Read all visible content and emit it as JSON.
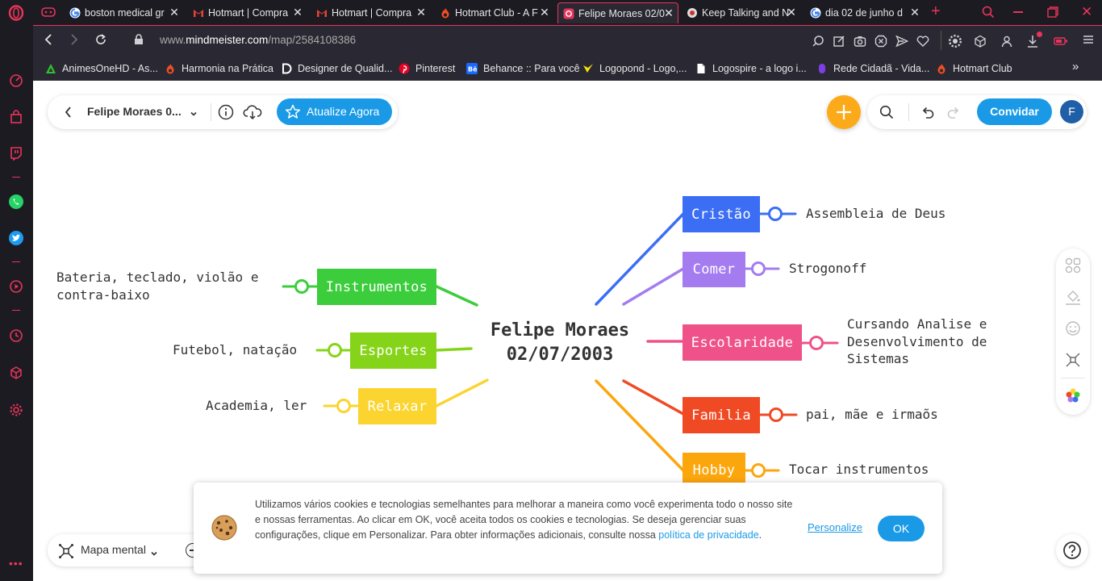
{
  "colors": {
    "browser_bg": "#1c1b22",
    "toolbar_bg": "#2a2933",
    "opera_red": "#e8345a",
    "accent_blue": "#1a9ae6",
    "add_orange": "#fcaa1a",
    "blue": "#3b6ef5",
    "purple": "#a47cf0",
    "pink": "#ef5289",
    "red": "#f04a24",
    "orange": "#fca60d",
    "green": "#3ccd3c",
    "lime": "#86d41a",
    "yellow": "#fbd42f"
  },
  "tabs": [
    {
      "title": "boston medical gr",
      "icon": "google-icon"
    },
    {
      "title": "Hotmart | Compra",
      "icon": "gmail-icon"
    },
    {
      "title": "Hotmart | Compra",
      "icon": "gmail-icon"
    },
    {
      "title": "Hotmart Club - A F",
      "icon": "hotmart-icon"
    },
    {
      "title": "Felipe Moraes 02/0",
      "icon": "mindmeister-icon",
      "active": true
    },
    {
      "title": "Keep Talking and N",
      "icon": "game-icon"
    },
    {
      "title": "dia 02 de junho d",
      "icon": "google-icon"
    }
  ],
  "address": {
    "prefix": "www.",
    "domain": "mindmeister.com",
    "path": "/map/2584108386"
  },
  "bookmarks": [
    {
      "label": "AnimesOneHD - As...",
      "icon": "animes-icon"
    },
    {
      "label": "Harmonia na Prática",
      "icon": "hotmart-icon"
    },
    {
      "label": "Designer de Qualid...",
      "icon": "designer-icon"
    },
    {
      "label": "Pinterest",
      "icon": "pinterest-icon"
    },
    {
      "label": "Behance :: Para você",
      "icon": "behance-icon"
    },
    {
      "label": "Logopond - Logo,...",
      "icon": "logopond-icon"
    },
    {
      "label": "Logospire - a logo i...",
      "icon": "file-icon"
    },
    {
      "label": "Rede Cidadã - Vida...",
      "icon": "rede-icon"
    },
    {
      "label": "Hotmart Club",
      "icon": "hotmart-icon"
    }
  ],
  "toolbar": {
    "map_title": "Felipe Moraes 0...",
    "upgrade_label": "Atualize Agora",
    "invite_label": "Convidar",
    "avatar_letter": "F"
  },
  "mindmap": {
    "root": "Felipe Moraes\n02/07/2003",
    "right": [
      {
        "label": "Cristão",
        "leaf": "Assembleia de Deus",
        "color": "#3b6ef5"
      },
      {
        "label": "Comer",
        "leaf": "Strogonoff",
        "color": "#a47cf0"
      },
      {
        "label": "Escolaridade",
        "leaf": "Cursando Analise e\nDesenvolvimento de\nSistemas",
        "color": "#ef5289"
      },
      {
        "label": "Familia",
        "leaf": "pai, mãe e irmaõs",
        "color": "#f04a24"
      },
      {
        "label": "Hobby",
        "leaf": "Tocar instrumentos",
        "color": "#fca60d"
      }
    ],
    "left": [
      {
        "label": "Instrumentos",
        "leaf": "Bateria, teclado, violão e\ncontra-baixo",
        "color": "#3ccd3c"
      },
      {
        "label": "Esportes",
        "leaf": "Futebol, natação",
        "color": "#86d41a"
      },
      {
        "label": "Relaxar",
        "leaf": "Academia, ler",
        "color": "#fbd42f"
      }
    ]
  },
  "bottom": {
    "view_label": "Mapa mental"
  },
  "cookie": {
    "text": "Utilizamos vários cookies e tecnologias semelhantes para melhorar a maneira como você experimenta todo o nosso site e nossas ferramentas. Ao clicar em OK, você aceita todos os cookies e tecnologias. Se deseja gerenciar suas configurações, clique em Personalizar. Para obter informações adicionais, consulte nossa ",
    "link": "política de privacidade",
    "end": ".",
    "personalize": "Personalize",
    "ok": "OK"
  }
}
